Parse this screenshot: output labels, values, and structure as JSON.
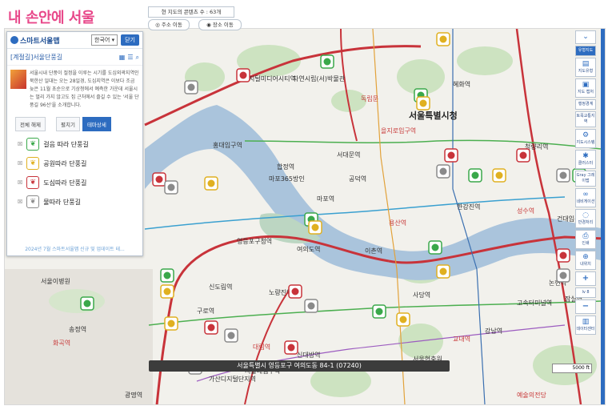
{
  "brand": {
    "caption": "내 손안에 서울"
  },
  "panel": {
    "logo": "스마트서울맵",
    "language": "한국어 ▾",
    "close_label": "닫기",
    "title": "[계절길]서울단풍길",
    "description": "서울시내 단풍이 절정을 이루는 시기를 도심외곽지역인 북한산 일대는 오는 28일경, 도심지역은 이보다 조금 늦은 11월 초순으로 기상청에서 예측한 가운데 서울시는 멀리 가지 않고도 집 근처에서 즐길 수 있는 '서울 단풍길 96선'을 소개합니다.",
    "tabs": [
      "전체 해제",
      "펼치기",
      "테마상세"
    ],
    "layers": [
      {
        "label": "걸음 따라 단풍길",
        "color": "#3aa84a"
      },
      {
        "label": "공원따라 단풍길",
        "color": "#e0b020"
      },
      {
        "label": "도심따라 단풍길",
        "color": "#c8333a"
      },
      {
        "label": "물따라 단풍길",
        "color": "#8a8a8a"
      }
    ],
    "update_note": "2024년 7월 스마트서울맵 신규 및 업데이트 테..."
  },
  "search": {
    "count_text": "현 지도의 콘텐츠 수 : 63개",
    "address_move": "주소 이동",
    "place_move": "장소 이동"
  },
  "toolbar": {
    "items": [
      "유형지도",
      "지도유형",
      "지도 캡처",
      "행정경계",
      "토목교통지역",
      "지도시스템",
      "클러스터",
      "Gray 그레이맵",
      "네비게이션",
      "반경처리",
      "인쇄",
      "내위치",
      "+",
      "lv 8",
      "−",
      "데이터센터"
    ],
    "zoom_level": "lv 8"
  },
  "map": {
    "city_label": "서울특별시청",
    "labels": [
      {
        "t": "지털미디어시티역"
      },
      {
        "t": "자연시립(서)박물관"
      },
      {
        "t": "독립문"
      },
      {
        "t": "혜화역"
      },
      {
        "t": "홍대입구역"
      },
      {
        "t": "합정역"
      },
      {
        "t": "서대문역"
      },
      {
        "t": "을지로입구역"
      },
      {
        "t": "청량리역"
      },
      {
        "t": "마포365방인"
      },
      {
        "t": "공덕역"
      },
      {
        "t": "마포역"
      },
      {
        "t": "용산역"
      },
      {
        "t": "한강진역"
      },
      {
        "t": "여의도역"
      },
      {
        "t": "영등포구청역"
      },
      {
        "t": "이촌역"
      },
      {
        "t": "성수역"
      },
      {
        "t": "건대입구역"
      },
      {
        "t": "노량진역"
      },
      {
        "t": "신도림역"
      },
      {
        "t": "구로역"
      },
      {
        "t": "대림역"
      },
      {
        "t": "신대방역"
      },
      {
        "t": "서울대입구역"
      },
      {
        "t": "사당역"
      },
      {
        "t": "강남역"
      },
      {
        "t": "교대역"
      },
      {
        "t": "잠실역"
      },
      {
        "t": "논현역"
      },
      {
        "t": "고속터미널역"
      },
      {
        "t": "광명역"
      },
      {
        "t": "예술의전당"
      },
      {
        "t": "서울현충원"
      },
      {
        "t": "가산디지털단지역"
      },
      {
        "t": "서울이병원"
      },
      {
        "t": "송정역"
      },
      {
        "t": "화곡역"
      }
    ]
  },
  "status": {
    "address": "서울특별시 영등포구 여의도동 84-1 (07240)",
    "scale": "5000 ft"
  }
}
